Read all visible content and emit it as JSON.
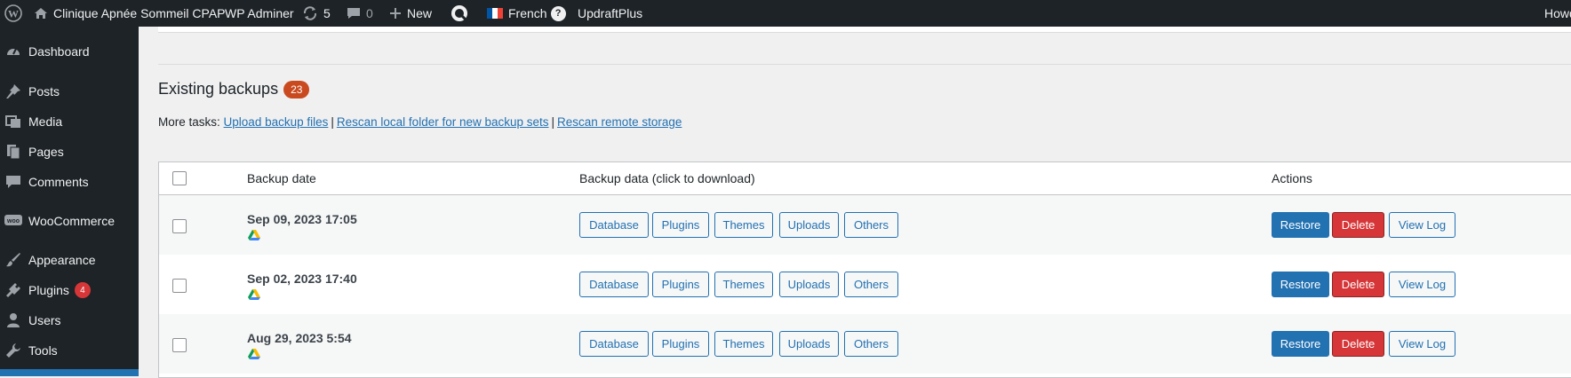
{
  "adminbar": {
    "site_name": "Clinique Apnée Sommeil CPAP",
    "wp_adminer": "WP Adminer",
    "updates_count": "5",
    "comments_count": "0",
    "new_label": "New",
    "language_label": "French",
    "help_label": "?",
    "updraft_label": "UpdraftPlus",
    "howdy": "Howd"
  },
  "sidebar": {
    "items": [
      {
        "label": "Dashboard",
        "icon": "dashboard-icon"
      },
      {
        "label": "Posts",
        "icon": "pin-icon"
      },
      {
        "label": "Media",
        "icon": "media-icon"
      },
      {
        "label": "Pages",
        "icon": "pages-icon"
      },
      {
        "label": "Comments",
        "icon": "comment-icon"
      },
      {
        "label": "WooCommerce",
        "icon": "woo-icon"
      },
      {
        "label": "Appearance",
        "icon": "brush-icon"
      },
      {
        "label": "Plugins",
        "icon": "plugin-icon",
        "badge": "4"
      },
      {
        "label": "Users",
        "icon": "user-icon"
      },
      {
        "label": "Tools",
        "icon": "wrench-icon"
      }
    ]
  },
  "backups": {
    "title": "Existing backups",
    "count": "23",
    "more_tasks_label": "More tasks:",
    "links": [
      "Upload backup files",
      "Rescan local folder for new backup sets",
      "Rescan remote storage"
    ],
    "separator": "|",
    "columns": [
      "Backup date",
      "Backup data (click to download)",
      "Actions"
    ],
    "rows": [
      {
        "date": "Sep 09, 2023 17:05"
      },
      {
        "date": "Sep 02, 2023 17:40"
      },
      {
        "date": "Aug 29, 2023 5:54"
      }
    ],
    "data_buttons": [
      "Database",
      "Plugins",
      "Themes",
      "Uploads",
      "Others"
    ],
    "actions": [
      "Restore",
      "Delete",
      "View Log"
    ]
  },
  "colors": {
    "accent": "#2271b1",
    "danger": "#d63638",
    "count_badge": "#ca4a1f",
    "adminbar": "#1d2327"
  }
}
